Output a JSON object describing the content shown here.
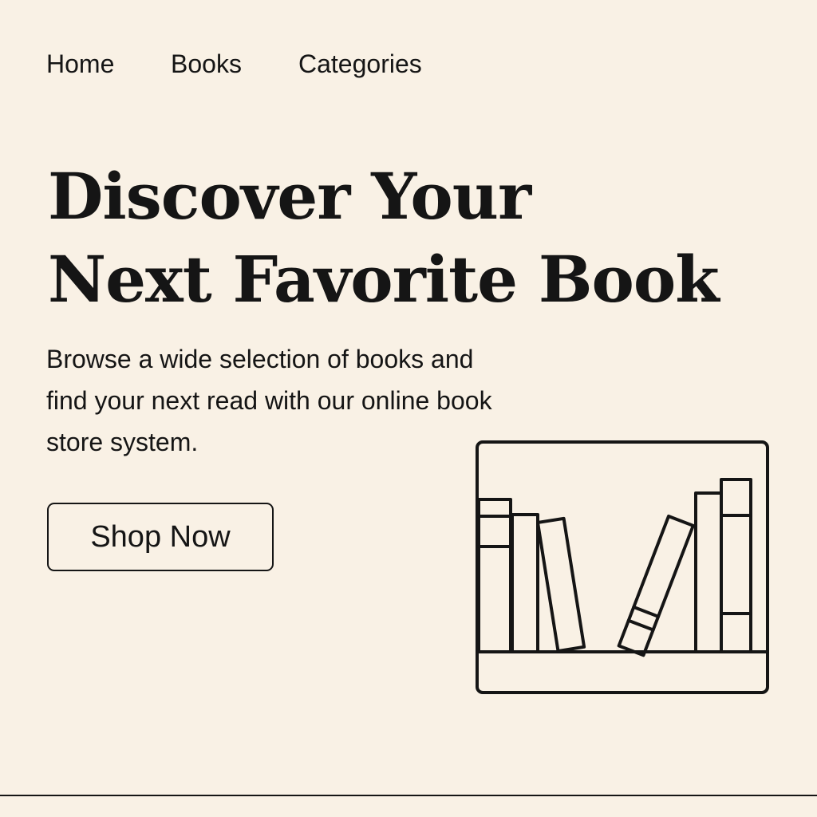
{
  "nav": {
    "items": [
      {
        "label": "Home"
      },
      {
        "label": "Books"
      },
      {
        "label": "Categories"
      }
    ]
  },
  "hero": {
    "title_line1": "Discover Your",
    "title_line2": "Next Favorite Book",
    "subtitle": "Browse a wide selection of books and find your next read with our online book store system.",
    "cta_label": "Shop Now"
  },
  "illustration": {
    "icon": "bookshelf-icon"
  },
  "colors": {
    "background": "#f9f1e5",
    "ink": "#151515"
  }
}
